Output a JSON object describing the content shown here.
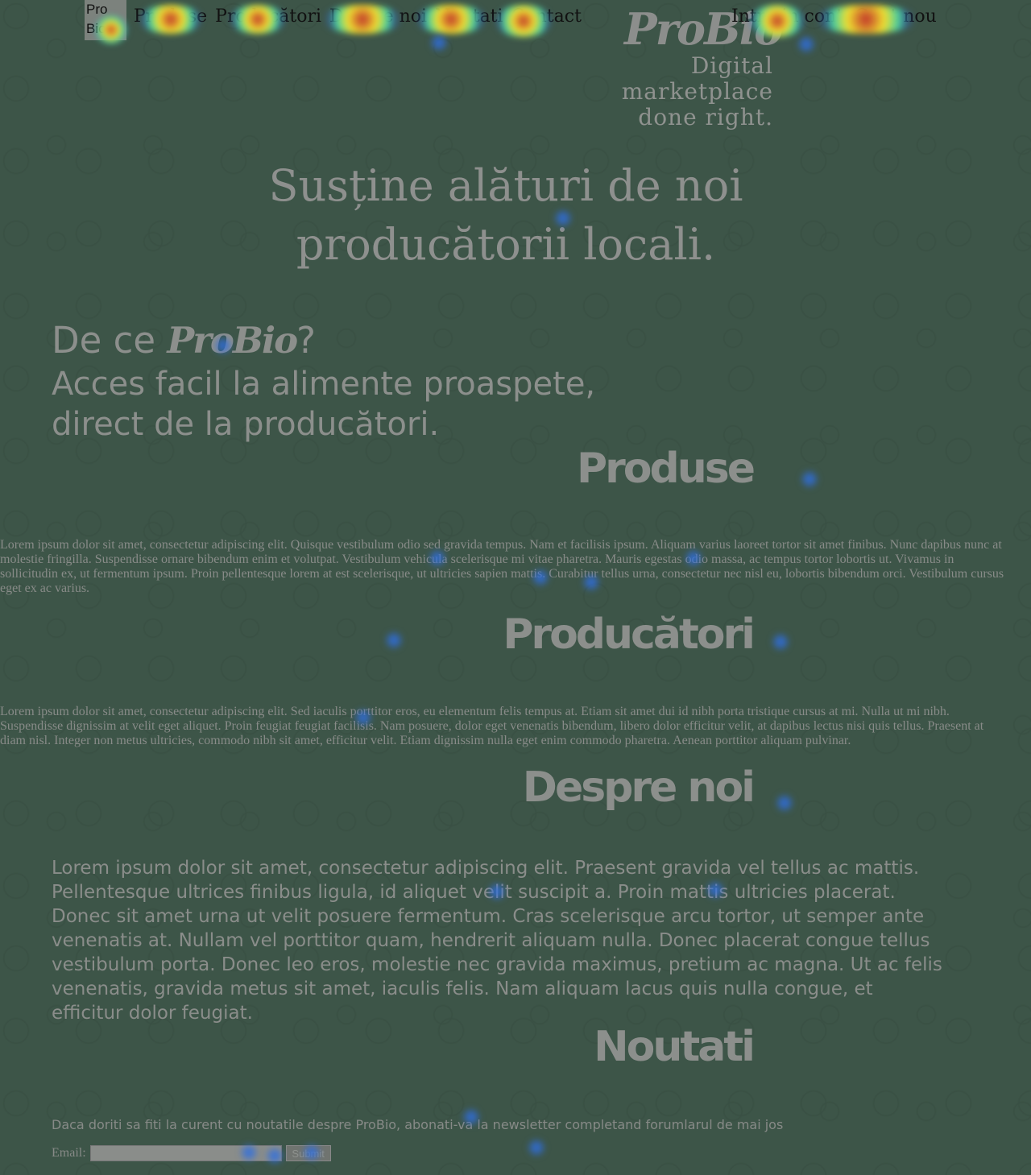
{
  "header": {
    "logo_line1": "Pro",
    "logo_line2": "Bio",
    "nav": [
      "Produse",
      "Producători",
      "Despre noi",
      "Noutati",
      "Contact"
    ],
    "nav_right": [
      "Intra in cont",
      "Cont nou"
    ],
    "brand": "ProBio",
    "tagline_line1": "Digital marketplace",
    "tagline_line2": "done right."
  },
  "hero": {
    "line1": "Susține alături de noi",
    "line2": "producătorii locali."
  },
  "why": {
    "prefix": "De ce ",
    "brand": "ProBio",
    "suffix": "?",
    "sub_line1": "Acces facil la alimente proaspete,",
    "sub_line2": "direct de la producători."
  },
  "sections": {
    "produse_title": "Produse",
    "produse_text": "Lorem ipsum dolor sit amet, consectetur adipiscing elit. Quisque vestibulum odio sed gravida tempus. Nam et facilisis ipsum. Aliquam varius laoreet tortor sit amet finibus. Nunc dapibus nunc at molestie fringilla. Suspendisse ornare bibendum enim et volutpat. Vestibulum vehicula scelerisque mi vitae pharetra. Mauris egestas odio massa, ac tempus tortor lobortis ut. Vivamus in sollicitudin ex, ut fermentum ipsum. Proin pellentesque lorem at est scelerisque, ut ultricies sapien mattis. Curabitur tellus urna, consectetur nec nisl eu, lobortis bibendum orci. Vestibulum cursus eget ex ac varius.",
    "producatori_title": "Producători",
    "producatori_text": "Lorem ipsum dolor sit amet, consectetur adipiscing elit. Sed iaculis porttitor eros, eu elementum felis tempus at. Etiam sit amet dui id nibh porta tristique cursus at mi. Nulla ut mi nibh. Suspendisse dignissim at velit eget aliquet. Proin feugiat feugiat facilisis. Nam posuere, dolor eget venenatis bibendum, libero dolor efficitur velit, at dapibus lectus nisi quis tellus. Praesent at diam nisl. Integer non metus ultricies, commodo nibh sit amet, efficitur velit. Etiam dignissim nulla eget enim commodo pharetra. Aenean porttitor aliquam pulvinar.",
    "despre_title": "Despre noi",
    "despre_text": "Lorem ipsum dolor sit amet, consectetur adipiscing elit. Praesent gravida vel tellus ac mattis. Pellentesque ultrices finibus ligula, id aliquet velit suscipit a. Proin mattis ultricies placerat. Donec sit amet urna ut velit posuere fermentum. Cras scelerisque arcu tortor, ut semper ante venenatis at. Nullam vel porttitor quam, hendrerit aliquam nulla. Donec placerat congue tellus vestibulum porta. Donec leo eros, molestie nec gravida maximus, pretium ac magna. Ut ac felis venenatis, gravida metus sit amet, iaculis felis. Nam aliquam lacus quis nulla congue, et efficitur dolor feugiat.",
    "noutati_title": "Noutati",
    "newsletter_text": "Daca doriti sa fiti la curent cu noutatile despre ProBio, abonati-va la newsletter completand forumlarul de mai jos",
    "email_label": "Email:",
    "submit_label": "Submit"
  },
  "colors": {
    "background": "#3d5548",
    "text": "#8a8d8a",
    "heat_blue": "#2f6fe0",
    "heat_red": "#c0302a"
  }
}
